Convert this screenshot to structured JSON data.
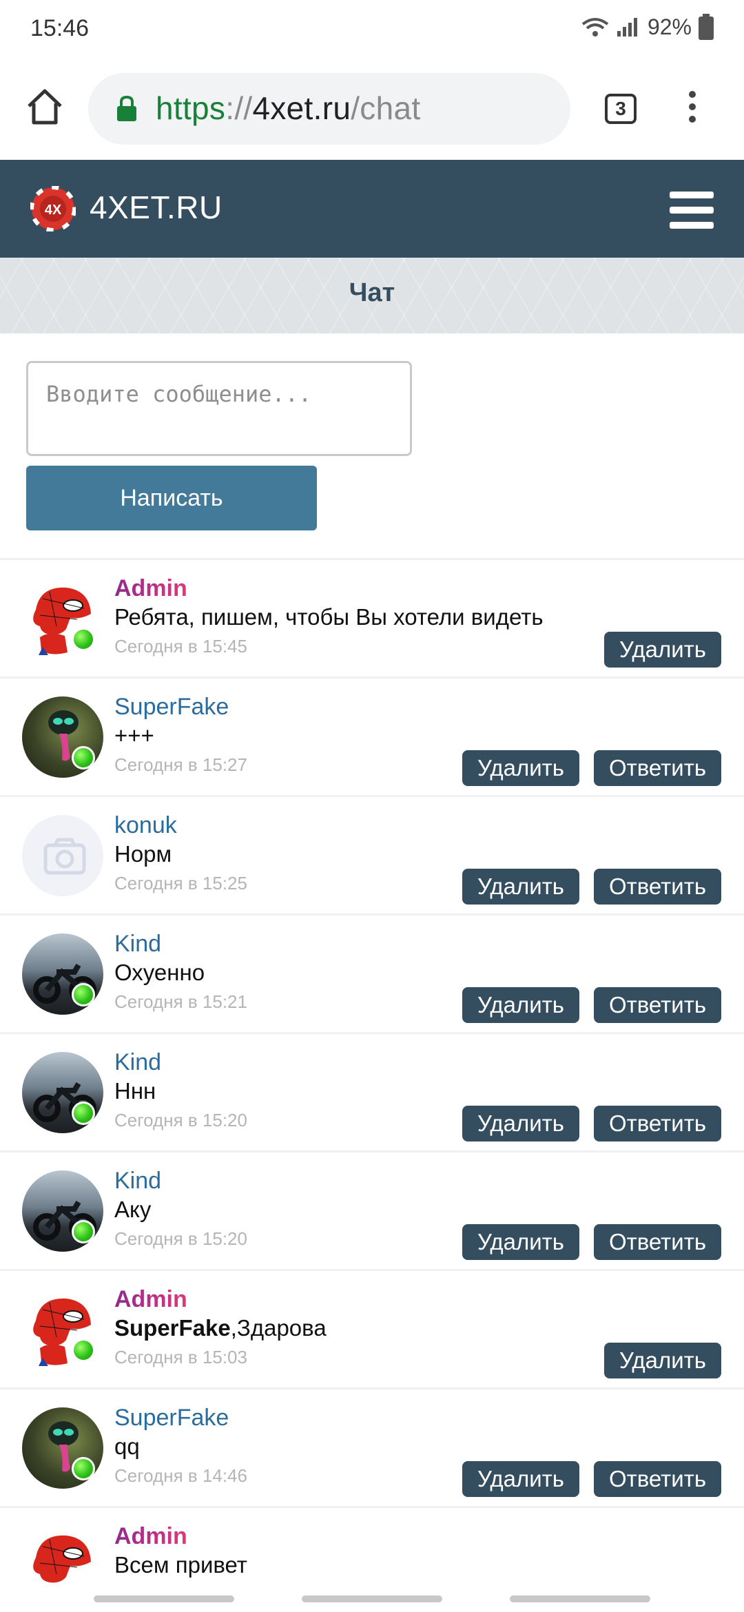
{
  "status_bar": {
    "time": "15:46",
    "battery": "92%"
  },
  "browser": {
    "url_scheme": "https",
    "url_sep": "://",
    "url_host": "4xet.ru",
    "url_path": "/chat",
    "tab_count": "3"
  },
  "site": {
    "name": "4XET.RU",
    "logo_text": "4X"
  },
  "page": {
    "title": "Чат"
  },
  "compose": {
    "placeholder": "Вводите сообщение...",
    "send_label": "Написать"
  },
  "labels": {
    "delete": "Удалить",
    "reply": "Ответить"
  },
  "messages": [
    {
      "user": "Admin",
      "text": "Ребята, пишем, чтобы Вы хотели видеть",
      "time": "Сегодня в 15:45"
    },
    {
      "user": "SuperFake",
      "text": "+++",
      "time": "Сегодня в 15:27"
    },
    {
      "user": "konuk",
      "text": "Норм",
      "time": "Сегодня в 15:25"
    },
    {
      "user": "Kind",
      "text": "Охуенно",
      "time": "Сегодня в 15:21"
    },
    {
      "user": "Kind",
      "text": "Ннн",
      "time": "Сегодня в 15:20"
    },
    {
      "user": "Kind",
      "text": "Аку",
      "time": "Сегодня в 15:20"
    },
    {
      "user": "Admin",
      "mention": "SuperFake",
      "text": ",Здарова",
      "time": "Сегодня в 15:03"
    },
    {
      "user": "SuperFake",
      "text": "qq",
      "time": "Сегодня в 14:46"
    },
    {
      "user": "Admin",
      "text": "Всем привет",
      "time": ""
    }
  ],
  "colors": {
    "header": "#344e60",
    "send_button": "#437a99",
    "username": "#2b6c9e",
    "admin_gradient": [
      "#8e2b8f",
      "#e2357a"
    ]
  }
}
